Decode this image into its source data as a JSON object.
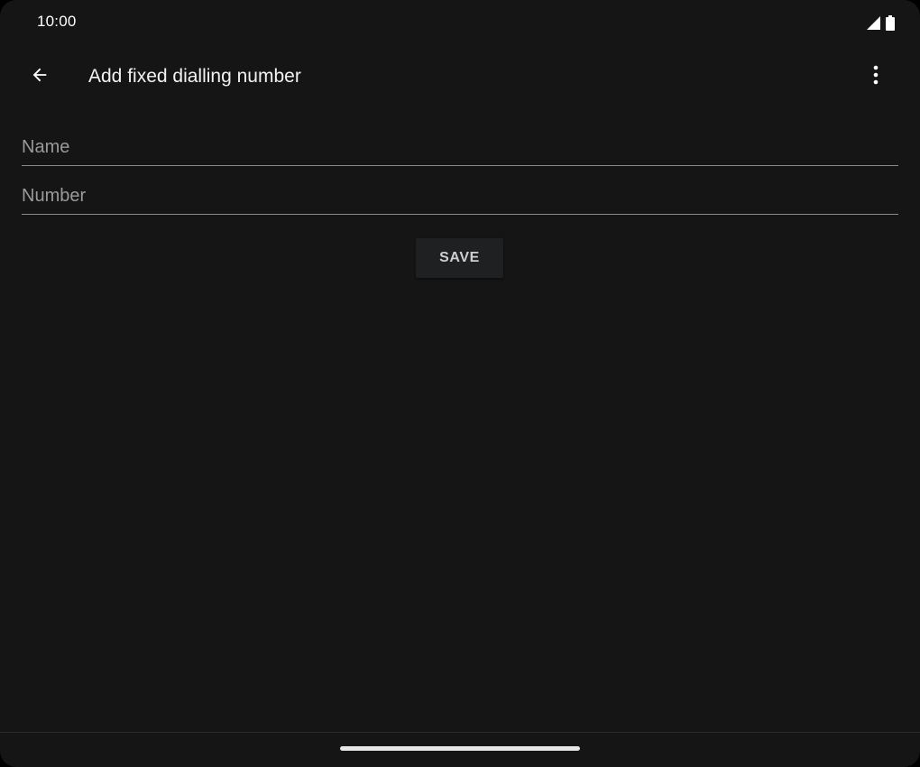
{
  "status_bar": {
    "time": "10:00",
    "icons": [
      "signal-icon",
      "battery-icon"
    ]
  },
  "app_bar": {
    "title": "Add fixed dialling number",
    "back_icon": "arrow-back-icon",
    "overflow_icon": "more-vert-icon"
  },
  "form": {
    "name": {
      "placeholder": "Name",
      "value": ""
    },
    "number": {
      "placeholder": "Number",
      "value": ""
    },
    "save_label": "SAVE"
  },
  "colors": {
    "background": "#151515",
    "text": "#f2f2f2",
    "hint": "#9a9a9a",
    "button_bg": "#1f2021"
  }
}
